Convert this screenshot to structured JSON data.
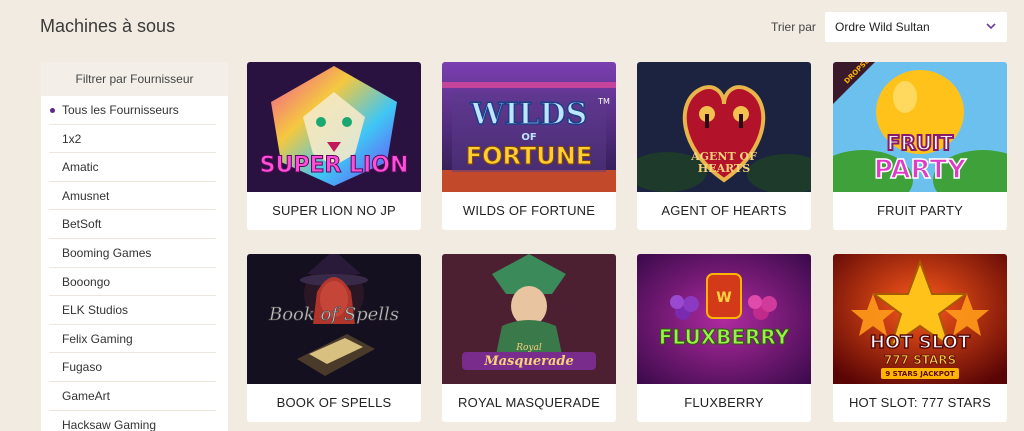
{
  "header": {
    "title": "Machines à sous",
    "sort_label": "Trier par",
    "sort_value": "Ordre Wild Sultan"
  },
  "sidebar": {
    "title": "Filtrer par Fournisseur",
    "items": [
      {
        "label": "Tous les Fournisseurs",
        "active": true
      },
      {
        "label": "1x2"
      },
      {
        "label": "Amatic"
      },
      {
        "label": "Amusnet"
      },
      {
        "label": "BetSoft"
      },
      {
        "label": "Booming Games"
      },
      {
        "label": "Booongo"
      },
      {
        "label": "ELK Studios"
      },
      {
        "label": "Felix Gaming"
      },
      {
        "label": "Fugaso"
      },
      {
        "label": "GameArt"
      },
      {
        "label": "Hacksaw Gaming"
      }
    ]
  },
  "games": [
    {
      "name": "SUPER LION NO JP",
      "logo": "SUPER LION",
      "bg": "#2a1240",
      "accent": "#e94aa8"
    },
    {
      "name": "WILDS OF FORTUNE",
      "logo": "WILDS OF FORTUNE",
      "bg": "#3b2a6b",
      "accent": "#f2c230"
    },
    {
      "name": "AGENT OF HEARTS",
      "logo": "AGENT OF HEARTS",
      "bg": "#1c1f3a",
      "accent": "#c41e3a"
    },
    {
      "name": "FRUIT PARTY",
      "logo": "FRUIT PARTY",
      "bg": "#5fb3e8",
      "accent": "#d946c0",
      "badge": "DROPS & WINS"
    },
    {
      "name": "BOOK OF SPELLS",
      "logo": "Book of Spells",
      "bg": "#14101f",
      "accent": "#8a2a3a"
    },
    {
      "name": "ROYAL MASQUERADE",
      "logo": "Royal Masquerade",
      "bg": "#3a1a2a",
      "accent": "#7a2c8c"
    },
    {
      "name": "FLUXBERRY",
      "logo": "FLUXBERRY",
      "bg": "#4a0f5c",
      "accent": "#7ddf3a"
    },
    {
      "name": "HOT SLOT: 777 STARS",
      "logo": "HOT SLOT",
      "sub": "777 STARS",
      "sub2": "9 STARS JACKPOT",
      "bg": "#7a0a0a",
      "accent": "#ffb400"
    }
  ]
}
